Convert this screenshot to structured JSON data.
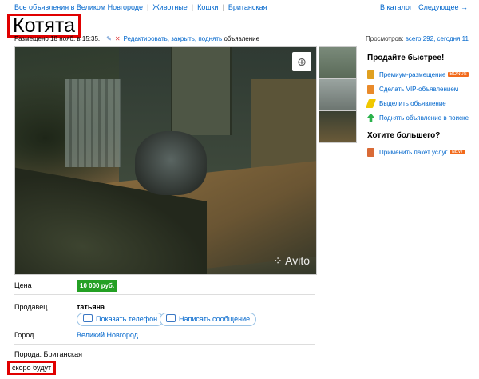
{
  "breadcrumb": [
    "Все объявления в Великом Новгороде",
    "Животные",
    "Кошки",
    "Британская"
  ],
  "topnav": {
    "catalog": "В каталог",
    "next": "Следующее →"
  },
  "title": "Котята",
  "meta": {
    "posted": "Размещено 18 нояб. в 15:35.",
    "edit_link": "Редактировать, закрыть, поднять",
    "edit_suffix": "объявление"
  },
  "views": {
    "label": "Просмотров:",
    "value": "всего 292, сегодня 11"
  },
  "photo": {
    "watermark": "Avito",
    "zoom_icon": "magnifier-plus-icon"
  },
  "sidebar": {
    "sell_heading": "Продайте быстрее!",
    "sell_items": [
      {
        "label": "Премиум-размещение",
        "badge": "BONUS",
        "icon": "premium-icon"
      },
      {
        "label": "Сделать VIP-объявлением",
        "icon": "vip-icon"
      },
      {
        "label": "Выделить объявление",
        "icon": "highlight-icon"
      },
      {
        "label": "Поднять объявление в поиске",
        "icon": "up-arrow-icon"
      }
    ],
    "more_heading": "Хотите большего?",
    "more_items": [
      {
        "label": "Применить пакет услуг",
        "badge": "NEW",
        "icon": "package-icon"
      }
    ]
  },
  "details": {
    "price_label": "Цена",
    "price_value": "10 000 руб.",
    "seller_label": "Продавец",
    "seller_name": "татьяна",
    "show_phone": "Показать телефон",
    "write_message": "Написать сообщение",
    "city_label": "Город",
    "city_value": "Великий Новгород",
    "breed": "Порода: Британская",
    "description": "скоро будут"
  }
}
